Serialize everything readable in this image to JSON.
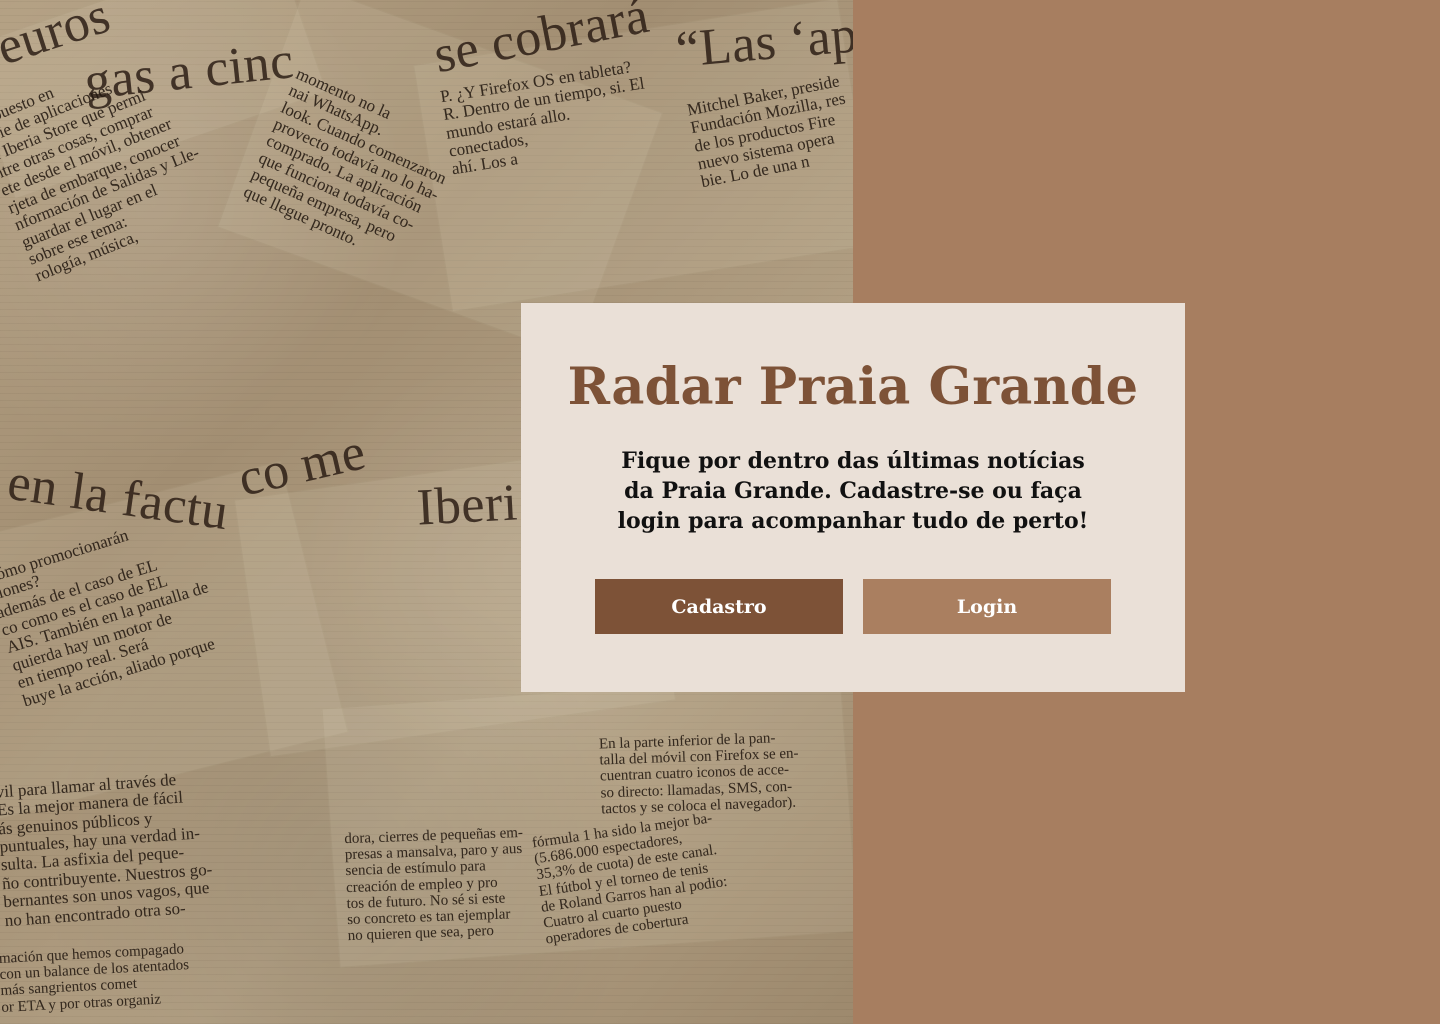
{
  "page": {
    "title": "Radar Praia Grande",
    "description": "Fique por dentro das últimas notícias da Praia Grande. Cadastre-se ou faça login para acompanhar tudo de perto!"
  },
  "actions": {
    "signup_label": "Cadastro",
    "login_label": "Login"
  },
  "background": {
    "headline_1": "euros",
    "headline_2": "gas a cinc",
    "headline_3": "se cobrará",
    "headline_4": "“Las ‘ap",
    "headline_5": "en la factu",
    "headline_6": "co me",
    "headline_7": "Iberi",
    "copy_1": "P. ¿Y Firefox OS en tableta?\nR. Dentro de un tiempo, si. El\nmundo estará allo.\nconectados,\nahí. Los a",
    "copy_2": "Mitchel Baker, preside\nFundación Mozilla, res\nde los productos Fire\nnuevo sistema opera\nbie. Lo de una n",
    "copy_3": "momento no la\nnai WhatsApp.\nlook. Cuando comenzaron\nprovecto todavía no lo ha-\ncomprado. La aplicación\nque funciona todavía co-\npequeña empresa, pero\nque llegue pronto.",
    "copy_4": "ha puesto en\nserie de aplicaciones\nla Iberia Store que permi\nntre otras cosas, comprar\nete desde el móvil, obtener\nrjeta de embarque, conocer\nnformación de Salidas y Lle-\nguardar el lugar en el\nsobre ese tema:\nrología, música,",
    "copy_5": "Cómo promocionarán\nciones?\nademás de el caso de EL\nco como es el caso de EL\nAIS. También en la pantalla de\nquierda hay un motor de\nen tiempo real. Será\nbuye la acción, aliado porque",
    "copy_6": "vil para llamar al través de\nEs la mejor manera de fácil\nás genuinos públicos y\npuntuales, hay una verdad in-\nsulta. La asfixia del peque-\nño contribuyente. Nuestros go-\nbernantes son unos vagos, que\nno han encontrado otra so-",
    "copy_7": "En la parte inferior de la pan-\ntalla del móvil con Firefox se en-\ncuentran cuatro iconos de acce-\nso directo: llamadas, SMS, con-\ntactos y se coloca el navegador).",
    "copy_8": "dora, cierres de pequeñas em-\npresas a mansalva, paro y aus\nsencia de estímulo para\ncreación de empleo y pro\ntos de futuro. No sé si este\nso concreto es tan ejemplar\nno quieren que sea, pero",
    "copy_9": "fórmula 1 ha sido la mejor ba-\n(5.686.000 espectadores,\n35,3% de cuota) de este canal.\nEl fútbol y el torneo de tenis\nde Roland Garros han al podio:\nCuatro al cuarto puesto\noperadores de cobertura",
    "copy_10": "mación que hemos compagado\ncon un balance de los atentados\nmás sangrientos comet\nor ETA y por otras organiz"
  }
}
